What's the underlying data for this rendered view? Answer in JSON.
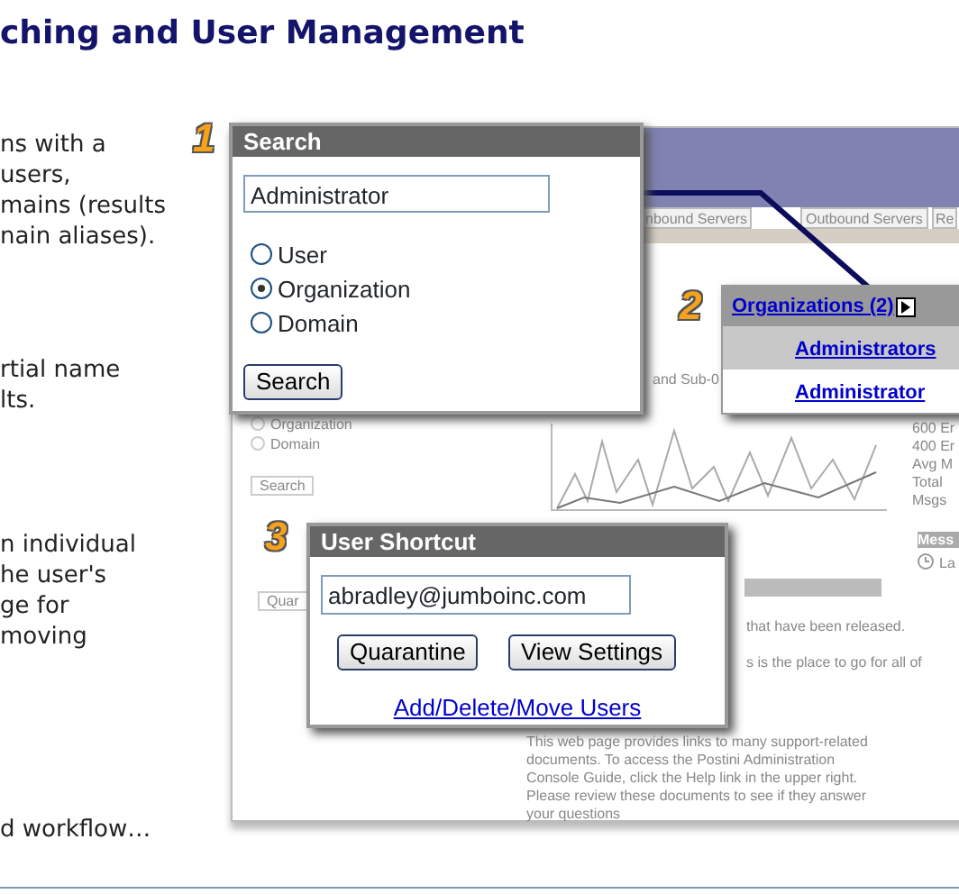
{
  "title": "ching and User Management",
  "left_paragraphs": [
    [
      "ns with a",
      "users,",
      "mains (results",
      "nain aliases)."
    ],
    [
      "rtial name",
      "lts."
    ],
    [
      "n individual",
      "he user's",
      "ge for",
      "moving"
    ],
    [
      "d workflow…"
    ]
  ],
  "background_screen": {
    "tabs": [
      "nbound Servers",
      "Outbound Servers",
      "Re"
    ],
    "search_options": [
      "Organization",
      "Domain"
    ],
    "search_button": "Search",
    "shortcut_button": "Quar",
    "chart_header": "and Sub-0",
    "stats": [
      "600 Er",
      "400 Er",
      "Avg M",
      "Total",
      "Msgs"
    ],
    "messages_header": "Mess",
    "messages_item": "La",
    "notes": [
      "that have been released.",
      "s is the place to go for all of"
    ],
    "help_text": "This web page provides links to many support-related documents. To access the Postini Administration Console Guide, click the Help link in the upper right. Please review these documents to see if they answer your questions"
  },
  "search_popup": {
    "badge": "1",
    "title": "Search",
    "query": "Administrator",
    "options": [
      {
        "label": "User",
        "selected": false
      },
      {
        "label": "Organization",
        "selected": true
      },
      {
        "label": "Domain",
        "selected": false
      }
    ],
    "button": "Search"
  },
  "results_popup": {
    "badge": "2",
    "heading": "Organizations (2)",
    "items": [
      {
        "label": "Administrators",
        "highlighted": true
      },
      {
        "label": "Administrator",
        "highlighted": false
      }
    ]
  },
  "shortcut_popup": {
    "badge": "3",
    "title": "User Shortcut",
    "email": "abradley@jumboinc.com",
    "buttons": [
      "Quarantine",
      "View Settings"
    ],
    "link": "Add/Delete/Move Users"
  }
}
